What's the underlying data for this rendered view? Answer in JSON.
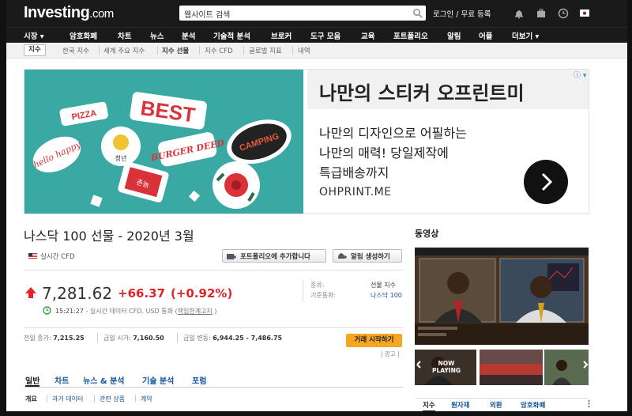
{
  "header": {
    "logo_main": "Investing",
    "logo_suffix": ".com",
    "search_placeholder": "웹사이트 검색",
    "login": "로그인 / 무료 등록"
  },
  "nav": {
    "items": [
      "시장",
      "암호화폐",
      "차트",
      "뉴스",
      "분석",
      "기술적 분석",
      "브로커",
      "도구 모음",
      "교육",
      "포트폴리오",
      "알림",
      "어플",
      "더보기"
    ]
  },
  "subnav": {
    "items": [
      "지수",
      "한국 지수",
      "세계 주요 지수",
      "지수 선물",
      "지수 CFD",
      "글로벌 지표",
      "내역"
    ]
  },
  "ad": {
    "info": "ⓘ",
    "title": "나만의 스티커 오프린트미",
    "line1": "나만의 디자인으로 어필하는",
    "line2": "나만의 매력! 당일제작에",
    "line3": "특급배송까지",
    "brand": "OHPRINT.ME",
    "sticker_best": "BEST",
    "sticker_burger": "BURGER DEED",
    "sticker_camping": "CAMPING",
    "sticker_pizza": "PIZZA",
    "sticker_hello": "hello happy",
    "sticker_cheong": "청년",
    "sticker_mandu": "촌놈"
  },
  "instrument": {
    "title": "나스닥 100 선물 - 2020년 3월",
    "realtime": "실시간 CFD",
    "btn_portfolio": "포트폴리오에 추가합니다",
    "btn_alert": "알림 생성하기",
    "price": "7,281.62",
    "change": "+66.37",
    "change_pct": "(+0.92%)",
    "time_val": "15:21:27",
    "time_desc": " - 실시간 데이터 CFD. USD 통화 (",
    "disclaimer": "책임한계고지",
    "time_end": " )",
    "type_label": "종류:",
    "type_value": "선물 지수",
    "base_label": "기준통화:",
    "base_value": "나스닥 100",
    "prev_label": "전일 종가:",
    "prev_value": "7,215.25",
    "open_label": "금일 시가:",
    "open_value": "7,160.50",
    "range_label": "금일 변동:",
    "range_value": "6,944.25 - 7,486.75",
    "trade_btn": "거래 시작하기",
    "ad_label": "| 광고 |"
  },
  "tabs": [
    "일반",
    "차트",
    "뉴스 & 분석",
    "기술 분석",
    "포럼"
  ],
  "subtabs": [
    "개요",
    "과거 데이터",
    "관련 상품",
    "계약"
  ],
  "right": {
    "heading": "동영상",
    "now_playing": "NOW PLAYING",
    "tabs": [
      "지수",
      "원자재",
      "외환",
      "암호화폐"
    ]
  },
  "colors": {
    "header_bg": "#1a1a1a",
    "down_red": "#e0242b",
    "link_blue": "#1256a0",
    "trade_orange": "#f5a623",
    "ad_teal": "#3aa8a3"
  }
}
